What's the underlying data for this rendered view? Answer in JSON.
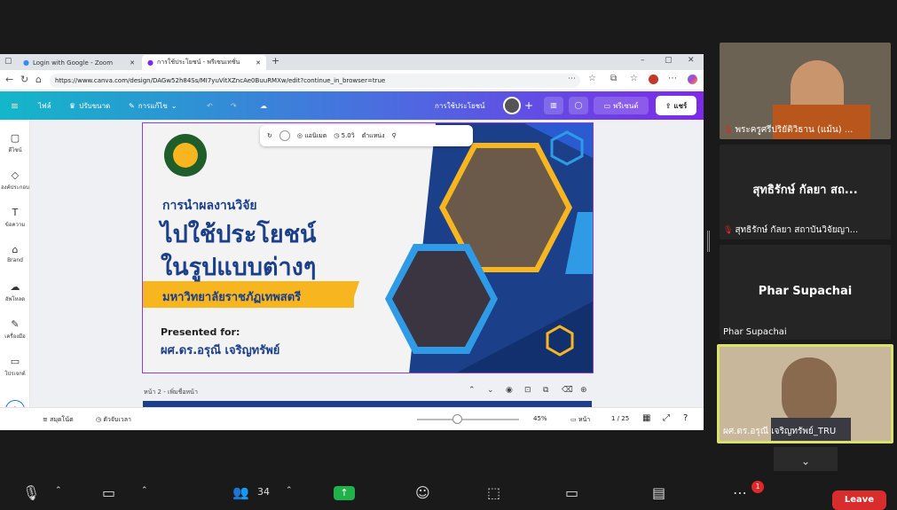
{
  "browser": {
    "tabs": [
      {
        "label": "Login with Google - Zoom"
      },
      {
        "label": "การใช้ประโยชน์ - พรีเซนเทชั่น"
      }
    ],
    "url": "https://www.canva.com/design/DAGw52h84Ss/MI7yuVitXZncAe0BuuRMXw/edit?continue_in_browser=true"
  },
  "canva": {
    "menu_file": "ไฟล์",
    "menu_resize": "ปรับขนาด",
    "menu_edit": "การแก้ไข",
    "design_title": "การใช้ประโยชน์",
    "present_label": "พรีเซนต์",
    "share_label": "แชร์",
    "sidebar": [
      {
        "label": "ดีไซน์"
      },
      {
        "label": "องค์ประกอบ"
      },
      {
        "label": "ข้อความ"
      },
      {
        "label": "Brand"
      },
      {
        "label": "อัพโหลด"
      },
      {
        "label": "เครื่องมือ"
      },
      {
        "label": "โปรเจกต์"
      }
    ],
    "toolbar": {
      "animate": "แอนิเมต",
      "duration": "5.0วิ",
      "position": "ตำแหน่ง"
    },
    "slide": {
      "heading_small": "การนำผลงานวิจัย",
      "heading_line2": "ไปใช้ประโยชน์",
      "heading_line3": "ในรูปแบบต่างๆ",
      "university": "มหาวิทยาลัยราชภัฏเทพสตรี",
      "presented_for": "Presented for:",
      "presenter": "ผศ.ดร.อรุณี เจริญทรัพย์"
    },
    "page_label": "หน้า 2 - เพิ่มชื่อหน้า",
    "bottom": {
      "notes": "สมุดโน้ต",
      "timer": "ตัวจับเวลา",
      "zoom": "45%",
      "pages": "หน้า",
      "page_count": "1 / 25"
    }
  },
  "participants": [
    {
      "name": "พระครูศรีปริยัติวิธาน (แม้น) ..."
    },
    {
      "name": "สุทธิรักษ์ กัลยา สถาบันวิจัยญา...",
      "display": "สุทธิรักษ์ กัลยา สถ..."
    },
    {
      "name": "Phar Supachai",
      "display": "Phar Supachai"
    },
    {
      "name": "ผศ.ดร.อรุณี เจริญทรัพย์_TRU"
    }
  ],
  "zoom_controls": {
    "participants_count": "34",
    "more_badge": "1",
    "leave": "Leave"
  }
}
